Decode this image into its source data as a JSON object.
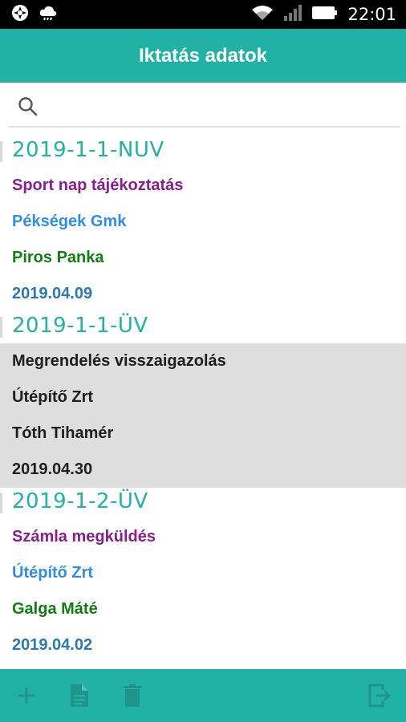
{
  "status_bar": {
    "time": "22:01",
    "icons": [
      "aperture-icon",
      "cloud-icon",
      "wifi-icon",
      "signal-icon",
      "battery-icon"
    ]
  },
  "app_bar": {
    "title": "Iktatás adatok"
  },
  "search": {
    "placeholder": "",
    "value": "",
    "icon": "search-icon"
  },
  "records": [
    {
      "id": "2019-1-1-NUV",
      "subject": "Sport nap tájékoztatás",
      "company": "Pékségek Gmk",
      "person": "Piros Panka",
      "date": "2019.04.09",
      "selected": false
    },
    {
      "id": "2019-1-1-ÜV",
      "subject": "Megrendelés visszaigazolás",
      "company": "Útépítő Zrt",
      "person": "Tóth Tihamér",
      "date": "2019.04.30",
      "selected": true
    },
    {
      "id": "2019-1-2-ÜV",
      "subject": "Számla megküldés",
      "company": "Útépítő Zrt",
      "person": "Galga Máté",
      "date": "2019.04.02",
      "selected": false
    }
  ],
  "bottom_bar": {
    "buttons": [
      "plus-icon",
      "document-icon",
      "trash-icon",
      "logout-icon"
    ]
  },
  "colors": {
    "accent": "#22b2a5",
    "subject": "#8b1d8f",
    "company": "#2f8ee6",
    "person": "#107e10",
    "date": "#2a79b6",
    "selected_bg": "#dedede",
    "bottom_icons": "#1f958a"
  }
}
